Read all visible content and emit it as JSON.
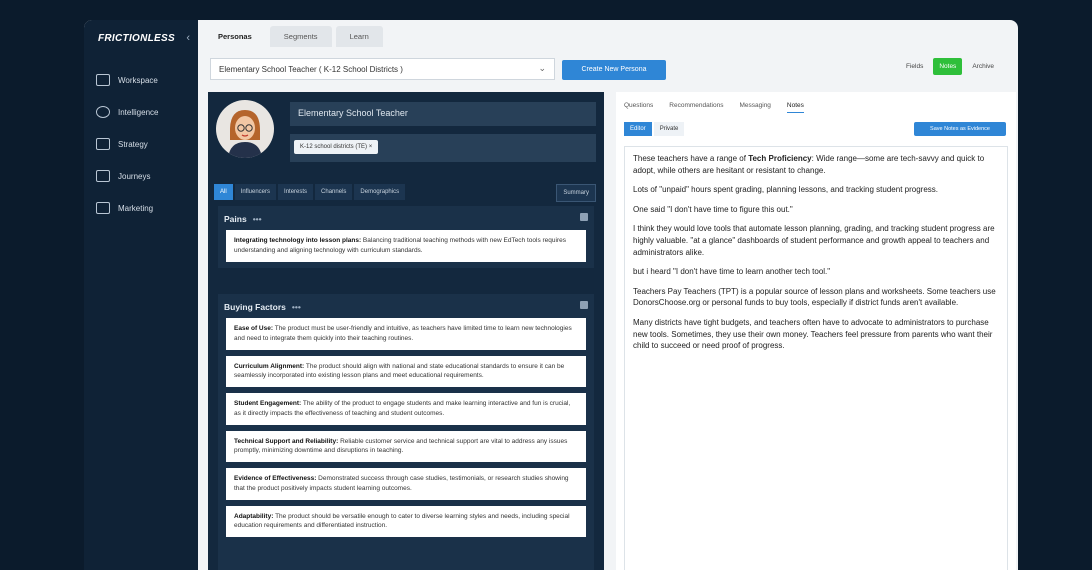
{
  "sidebar": {
    "logo": "FRICTIONLESS",
    "collapse": "‹",
    "items": [
      {
        "label": "Workspace"
      },
      {
        "label": "Intelligence"
      },
      {
        "label": "Strategy"
      },
      {
        "label": "Journeys"
      },
      {
        "label": "Marketing"
      }
    ]
  },
  "tabs": [
    "Personas",
    "Segments",
    "Learn"
  ],
  "persona_select": {
    "value": "Elementary School Teacher ( K-12 School Districts )"
  },
  "new_persona_button": "Create New Persona",
  "segmented": [
    "Fields",
    "Notes",
    "Archive"
  ],
  "persona": {
    "name": "Elementary School Teacher",
    "segment_chip": "K-12 school districts (TE)"
  },
  "filters": [
    "All",
    "Influencers",
    "Interests",
    "Channels",
    "Demographics"
  ],
  "summary_button": "Summary",
  "pains": {
    "title": "Pains",
    "dots": "•••",
    "items": [
      {
        "head": "Integrating technology into lesson plans:",
        "body": " Balancing traditional teaching methods with new EdTech tools requires understanding and aligning technology with curriculum standards."
      }
    ]
  },
  "buying_factors": {
    "title": "Buying Factors",
    "dots": "•••",
    "items": [
      {
        "head": "Ease of Use:",
        "body": " The product must be user-friendly and intuitive, as teachers have limited time to learn new technologies and need to integrate them quickly into their teaching routines."
      },
      {
        "head": "Curriculum Alignment:",
        "body": " The product should align with national and state educational standards to ensure it can be seamlessly incorporated into existing lesson plans and meet educational requirements."
      },
      {
        "head": "Student Engagement:",
        "body": " The ability of the product to engage students and make learning interactive and fun is crucial, as it directly impacts the effectiveness of teaching and student outcomes."
      },
      {
        "head": "Technical Support and Reliability:",
        "body": " Reliable customer service and technical support are vital to address any issues promptly, minimizing downtime and disruptions in teaching."
      },
      {
        "head": "Evidence of Effectiveness:",
        "body": " Demonstrated success through case studies, testimonials, or research studies showing that the product positively impacts student learning outcomes."
      },
      {
        "head": "Adaptability:",
        "body": " The product should be versatile enough to cater to diverse learning styles and needs, including special education requirements and differentiated instruction."
      }
    ]
  },
  "right": {
    "tabs": [
      "Questions",
      "Recommendations",
      "Messaging",
      "Notes"
    ],
    "edit_tabs": [
      "Editor",
      "Private"
    ],
    "action_button": "Save Notes as Evidence",
    "notes": [
      {
        "pre": "These teachers have a range of ",
        "bold": "Tech Proficiency",
        "post": ": Wide range—some are tech-savvy and quick to adopt, while others are hesitant or resistant to change."
      },
      {
        "pre": "Lots of \"unpaid\" hours spent grading, planning lessons, and tracking student progress.",
        "bold": "",
        "post": ""
      },
      {
        "pre": "One said \"I don't have time to figure this out.\"",
        "bold": "",
        "post": ""
      },
      {
        "pre": "I think they would love tools that automate lesson planning, grading, and tracking student progress are highly valuable. \"at a glance\" dashboards of student performance and growth appeal to teachers and administrators alike.",
        "bold": "",
        "post": ""
      },
      {
        "pre": "but i heard \"I don't have time to learn another tech tool.\"",
        "bold": "",
        "post": ""
      },
      {
        "pre": "Teachers Pay Teachers (TPT) is a popular source of lesson plans and worksheets.  Some teachers use DonorsChoose.org or personal funds to buy tools, especially if district funds aren't available.",
        "bold": "",
        "post": ""
      },
      {
        "pre": "Many districts have tight budgets, and teachers often have to advocate to administrators to purchase new tools. Sometimes, they use their own money.  Teachers feel pressure from parents who want their child to succeed or need proof of progress.",
        "bold": "",
        "post": ""
      }
    ]
  }
}
